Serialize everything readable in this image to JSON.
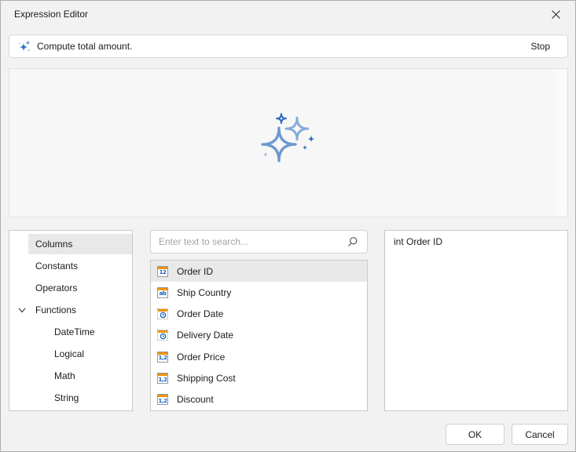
{
  "window": {
    "title": "Expression Editor"
  },
  "ai_bar": {
    "prompt": "Compute total amount.",
    "stop_label": "Stop"
  },
  "categories": {
    "items": [
      {
        "label": "Columns"
      },
      {
        "label": "Constants"
      },
      {
        "label": "Operators"
      },
      {
        "label": "Functions"
      },
      {
        "label": "DateTime"
      },
      {
        "label": "Logical"
      },
      {
        "label": "Math"
      },
      {
        "label": "String"
      }
    ]
  },
  "search": {
    "placeholder": "Enter text to search..."
  },
  "columns": {
    "items": [
      {
        "label": "Order ID",
        "type": "int",
        "icon_text": "12"
      },
      {
        "label": "Ship Country",
        "type": "string",
        "icon_text": "ab"
      },
      {
        "label": "Order Date",
        "type": "date",
        "icon_text": ""
      },
      {
        "label": "Delivery Date",
        "type": "date",
        "icon_text": ""
      },
      {
        "label": "Order Price",
        "type": "decimal",
        "icon_text": "1,2"
      },
      {
        "label": "Shipping Cost",
        "type": "decimal",
        "icon_text": "1,2"
      },
      {
        "label": "Discount",
        "type": "decimal",
        "icon_text": "1,2"
      }
    ]
  },
  "expression": {
    "text": "int Order ID"
  },
  "footer": {
    "ok_label": "OK",
    "cancel_label": "Cancel"
  },
  "colors": {
    "accent_blue": "#2e70c4",
    "sparkle_light_blue": "#6b98cf",
    "icon_orange": "#f0920c",
    "icon_blue": "#1460bd",
    "selection_gray": "#e8e8e8"
  }
}
